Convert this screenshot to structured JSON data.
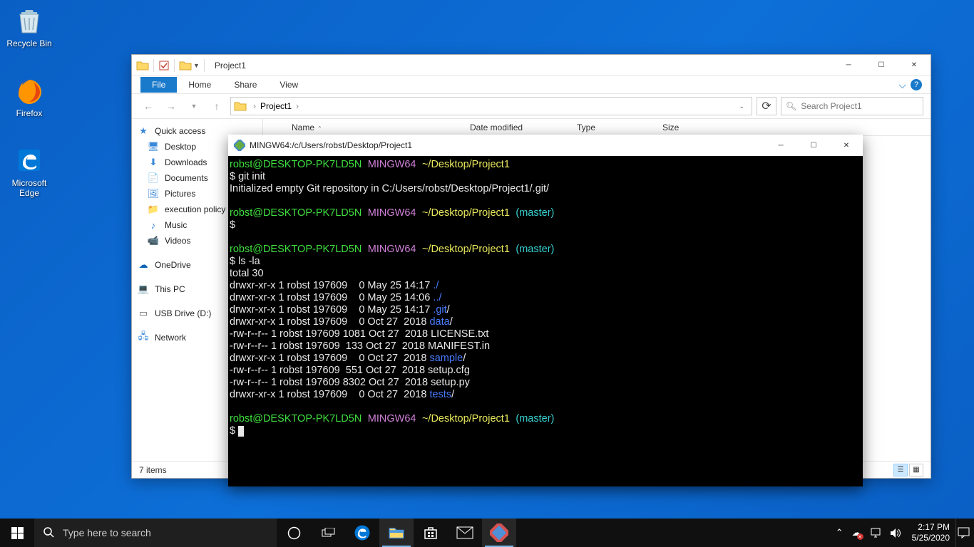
{
  "desktop": {
    "icons": [
      {
        "label": "Recycle Bin",
        "icon": "recycle"
      },
      {
        "label": "Firefox",
        "icon": "firefox"
      },
      {
        "label": "Microsoft Edge",
        "icon": "edge"
      }
    ]
  },
  "explorer": {
    "title": "Project1",
    "tabs": {
      "file": "File",
      "home": "Home",
      "share": "Share",
      "view": "View"
    },
    "breadcrumbs": [
      "Project1"
    ],
    "search_placeholder": "Search Project1",
    "columns": [
      "Name",
      "Date modified",
      "Type",
      "Size"
    ],
    "sidebar": {
      "quick_access": "Quick access",
      "quick_items": [
        "Desktop",
        "Downloads",
        "Documents",
        "Pictures",
        "execution policy",
        "Music",
        "Videos"
      ],
      "onedrive": "OneDrive",
      "this_pc": "This PC",
      "usb": "USB Drive (D:)",
      "network": "Network"
    },
    "status": "7 items"
  },
  "terminal": {
    "title": "MINGW64:/c/Users/robst/Desktop/Project1",
    "prompt": {
      "user": "robst@DESKTOP-PK7LD5N",
      "env": "MINGW64",
      "path": "~/Desktop/Project1",
      "branch": "(master)"
    },
    "lines": {
      "cmd1": "$ git init",
      "output1": "Initialized empty Git repository in C:/Users/robst/Desktop/Project1/.git/",
      "cmd2": "$",
      "cmd3": "$ ls -la",
      "total": "total 30",
      "ls": [
        {
          "perm": "drwxr-xr-x 1 robst 197609    0 May 25 14:17 ",
          "name": "./",
          "color": "blue"
        },
        {
          "perm": "drwxr-xr-x 1 robst 197609    0 May 25 14:06 ",
          "name": "../",
          "color": "blue"
        },
        {
          "perm": "drwxr-xr-x 1 robst 197609    0 May 25 14:17 ",
          "name": ".git",
          "suffix": "/",
          "color": "blue"
        },
        {
          "perm": "drwxr-xr-x 1 robst 197609    0 Oct 27  2018 ",
          "name": "data",
          "suffix": "/",
          "color": "blue"
        },
        {
          "perm": "-rw-r--r-- 1 robst 197609 1081 Oct 27  2018 ",
          "name": "LICENSE.txt",
          "color": "white"
        },
        {
          "perm": "-rw-r--r-- 1 robst 197609  133 Oct 27  2018 ",
          "name": "MANIFEST.in",
          "color": "white"
        },
        {
          "perm": "drwxr-xr-x 1 robst 197609    0 Oct 27  2018 ",
          "name": "sample",
          "suffix": "/",
          "color": "blue"
        },
        {
          "perm": "-rw-r--r-- 1 robst 197609  551 Oct 27  2018 ",
          "name": "setup.cfg",
          "color": "white"
        },
        {
          "perm": "-rw-r--r-- 1 robst 197609 8302 Oct 27  2018 ",
          "name": "setup.py",
          "color": "white"
        },
        {
          "perm": "drwxr-xr-x 1 robst 197609    0 Oct 27  2018 ",
          "name": "tests",
          "suffix": "/",
          "color": "blue"
        }
      ]
    }
  },
  "taskbar": {
    "search_placeholder": "Type here to search",
    "time": "2:17 PM",
    "date": "5/25/2020"
  }
}
